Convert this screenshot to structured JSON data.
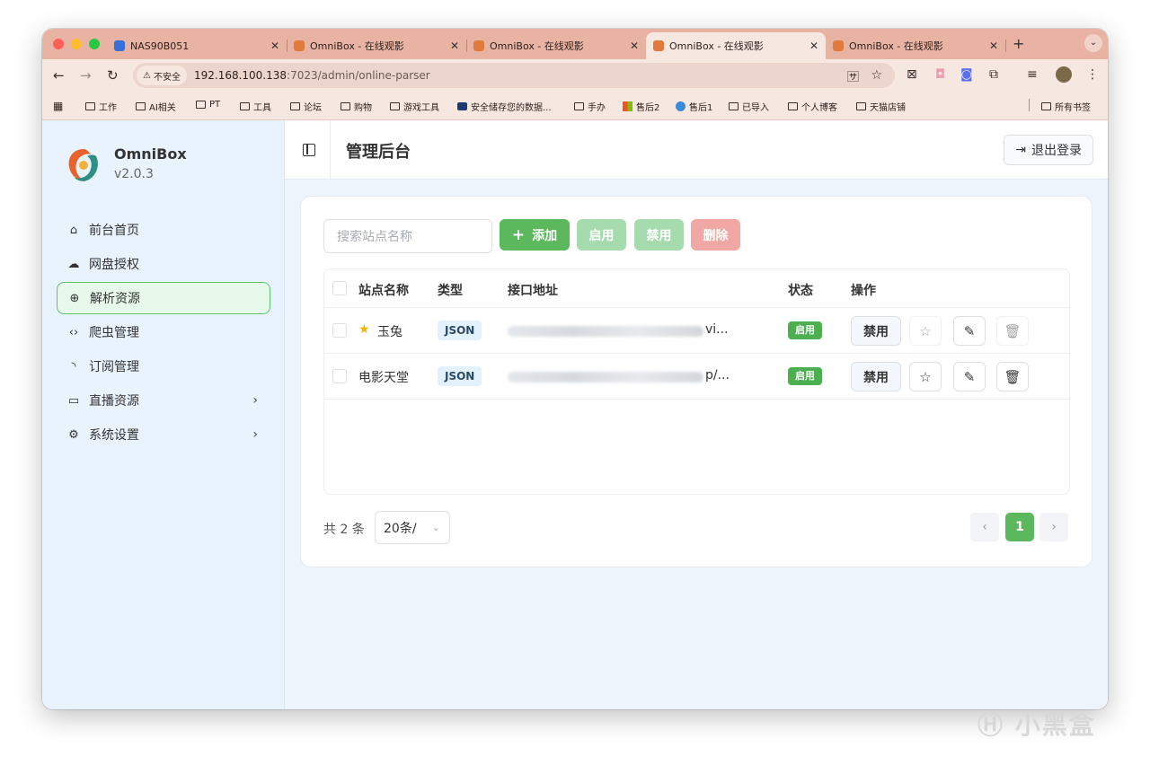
{
  "browser": {
    "tabs": [
      {
        "title": "NAS90B051",
        "active": false
      },
      {
        "title": "OmniBox - 在线观影",
        "active": false
      },
      {
        "title": "OmniBox - 在线观影",
        "active": false
      },
      {
        "title": "OmniBox - 在线观影",
        "active": true
      },
      {
        "title": "OmniBox - 在线观影",
        "active": false
      }
    ],
    "security_label": "不安全",
    "url_host": "192.168.100.138",
    "url_rest": ":7023/admin/online-parser",
    "bookmarks": [
      "工作",
      "AI相关",
      "PT",
      "工具",
      "论坛",
      "购物",
      "游戏工具",
      "安全储存您的数据...",
      "手办",
      "售后2",
      "售后1",
      "已导入",
      "个人博客",
      "天猫店铺"
    ],
    "all_bookmarks": "所有书签"
  },
  "sidebar": {
    "app_name": "OmniBox",
    "version": "v2.0.3",
    "items": [
      {
        "label": "前台首页",
        "icon": "home-icon"
      },
      {
        "label": "网盘授权",
        "icon": "cloud-icon"
      },
      {
        "label": "解析资源",
        "icon": "globe-icon",
        "active": true
      },
      {
        "label": "爬虫管理",
        "icon": "code-icon"
      },
      {
        "label": "订阅管理",
        "icon": "rss-icon"
      },
      {
        "label": "直播资源",
        "icon": "tv-icon",
        "expandable": true
      },
      {
        "label": "系统设置",
        "icon": "gear-icon",
        "expandable": true
      }
    ]
  },
  "header": {
    "title": "管理后台",
    "logout_label": "退出登录"
  },
  "toolbar": {
    "search_placeholder": "搜索站点名称",
    "add_label": "添加",
    "enable_label": "启用",
    "disable_label": "禁用",
    "delete_label": "删除"
  },
  "table": {
    "columns": [
      "站点名称",
      "类型",
      "接口地址",
      "状态",
      "操作"
    ],
    "rows": [
      {
        "name": "玉兔",
        "starred": true,
        "type": "JSON",
        "url_tail": "vi...",
        "status": "启用",
        "action": "禁用"
      },
      {
        "name": "电影天堂",
        "starred": false,
        "type": "JSON",
        "url_tail": "p/...",
        "status": "启用",
        "action": "禁用"
      }
    ]
  },
  "pagination": {
    "total_text": "共 2 条",
    "page_size": "20条/",
    "current_page": "1"
  },
  "colors": {
    "primary": "#5cb85c",
    "danger_light": "#f1a7a3",
    "sidebar_bg": "#e8f3fe"
  },
  "watermark": "小黑盒"
}
